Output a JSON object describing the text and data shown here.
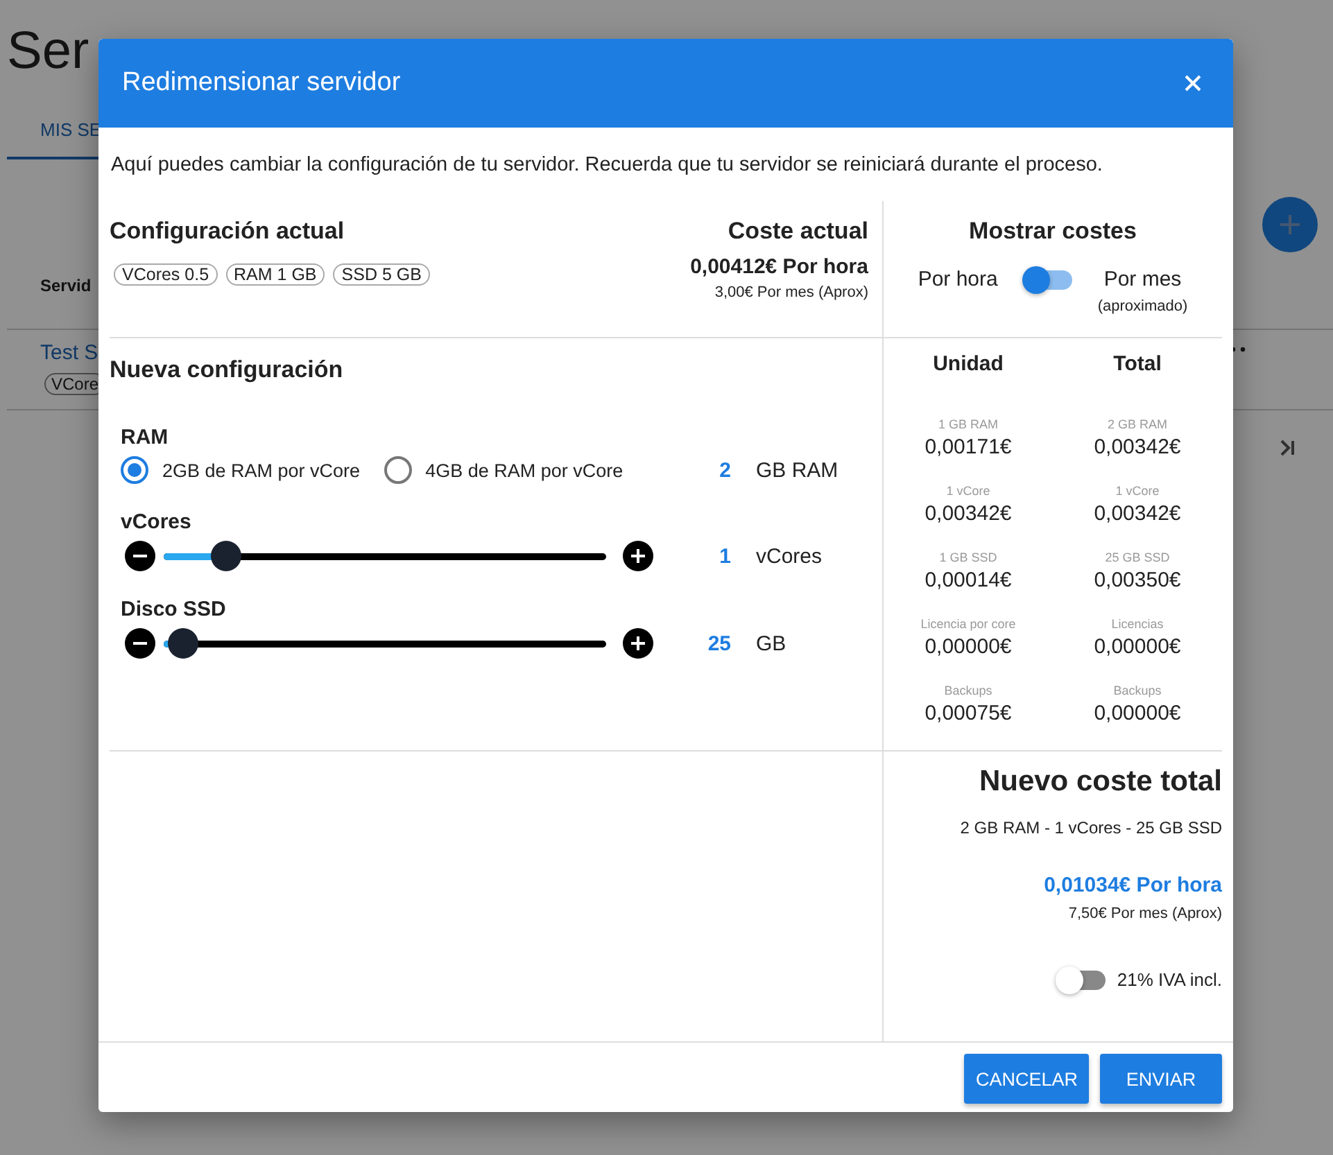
{
  "background": {
    "title": "Ser",
    "tab": "MIS SE",
    "column_header": "Servid",
    "row_link": "Test S",
    "row_chip": "VCore"
  },
  "dialog": {
    "title": "Redimensionar servidor",
    "intro": "Aquí puedes cambiar la configuración de tu servidor. Recuerda que tu servidor se reiniciará durante el proceso.",
    "current": {
      "heading": "Configuración actual",
      "chips": [
        "VCores 0.5",
        "RAM 1 GB",
        "SSD 5 GB"
      ],
      "cost_heading": "Coste actual",
      "hourly": "0,00412€ Por hora",
      "monthly": "3,00€ Por mes (Aprox)"
    },
    "display": {
      "heading": "Mostrar costes",
      "left_label": "Por hora",
      "right_label": "Por mes",
      "right_note": "(aproximado)",
      "monthly_on": false
    },
    "new_config": {
      "heading": "Nueva configuración",
      "ram": {
        "label": "RAM",
        "options": [
          {
            "label": "2GB de RAM por vCore",
            "selected": true
          },
          {
            "label": "4GB de RAM por vCore",
            "selected": false
          }
        ],
        "value": "2",
        "unit": "GB RAM"
      },
      "sliders": [
        {
          "label": "vCores",
          "level": 0.14,
          "value": "1",
          "unit": "vCores"
        },
        {
          "label": "Disco SSD",
          "level": 0.045,
          "value": "25",
          "unit": "GB"
        }
      ]
    },
    "breakdown": {
      "columns": [
        "Unidad",
        "Total"
      ],
      "rows": [
        [
          {
            "caption": "1 GB RAM",
            "amount": "0,00171€"
          },
          {
            "caption": "2 GB RAM",
            "amount": "0,00342€"
          }
        ],
        [
          {
            "caption": "1 vCore",
            "amount": "0,00342€"
          },
          {
            "caption": "1 vCore",
            "amount": "0,00342€"
          }
        ],
        [
          {
            "caption": "1 GB SSD",
            "amount": "0,00014€"
          },
          {
            "caption": "25 GB SSD",
            "amount": "0,00350€"
          }
        ],
        [
          {
            "caption": "Licencia por core",
            "amount": "0,00000€"
          },
          {
            "caption": "Licencias",
            "amount": "0,00000€"
          }
        ],
        [
          {
            "caption": "Backups",
            "amount": "0,00075€"
          },
          {
            "caption": "Backups",
            "amount": "0,00000€"
          }
        ]
      ]
    },
    "total": {
      "heading": "Nuevo coste total",
      "summary": "2 GB RAM - 1 vCores - 25 GB SSD",
      "hourly": "0,01034€ Por hora",
      "monthly": "7,50€ Por mes (Aprox)",
      "vat_label": "21% IVA incl.",
      "vat_on": false
    },
    "buttons": [
      "CANCELAR",
      "ENVIAR"
    ]
  }
}
